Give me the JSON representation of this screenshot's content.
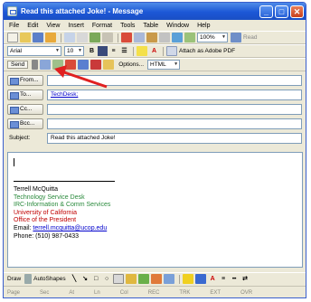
{
  "window": {
    "title": "Read this attached Joke! - Message",
    "buttons": {
      "minimize": "_",
      "maximize": "□",
      "close": "✕"
    }
  },
  "menu": [
    "File",
    "Edit",
    "View",
    "Insert",
    "Format",
    "Tools",
    "Table",
    "Window",
    "Help"
  ],
  "toolbar1": {
    "zoom": "100%",
    "read_label": "Read"
  },
  "toolbar2": {
    "font": "Arial",
    "size": "10",
    "attach_pdf": "Attach as Adobe PDF"
  },
  "toolbar3": {
    "send": "Send",
    "options": "Options...",
    "format": "HTML"
  },
  "fields": {
    "from_label": "From...",
    "from_value": "",
    "to_label": "To...",
    "to_value": "TechDesk;",
    "cc_label": "Cc...",
    "cc_value": "",
    "bcc_label": "Bcc...",
    "bcc_value": "",
    "subject_label": "Subject:",
    "subject_value": "Read this attached Joke!"
  },
  "signature": {
    "name": "Terrell McQuitta",
    "dept": "Technology Service Desk",
    "unit": "IRC-Information & Comm Services",
    "university": "University of California",
    "office": "Office of the President",
    "email_label": "Email:",
    "email": "terrell.mcquitta@ucop.edu",
    "phone": "Phone: (510) 987-0433"
  },
  "drawbar": {
    "draw": "Draw",
    "autoshapes": "AutoShapes"
  },
  "status": [
    "Page",
    "Sec",
    "At",
    "Ln",
    "Col",
    "REC",
    "TRK",
    "EXT",
    "OVR"
  ],
  "colors": {
    "title_bar": "#1c57d6",
    "arrow": "#e02020",
    "sig_green": "#2a8a3c",
    "sig_red": "#c00000",
    "link": "#0000cc"
  }
}
